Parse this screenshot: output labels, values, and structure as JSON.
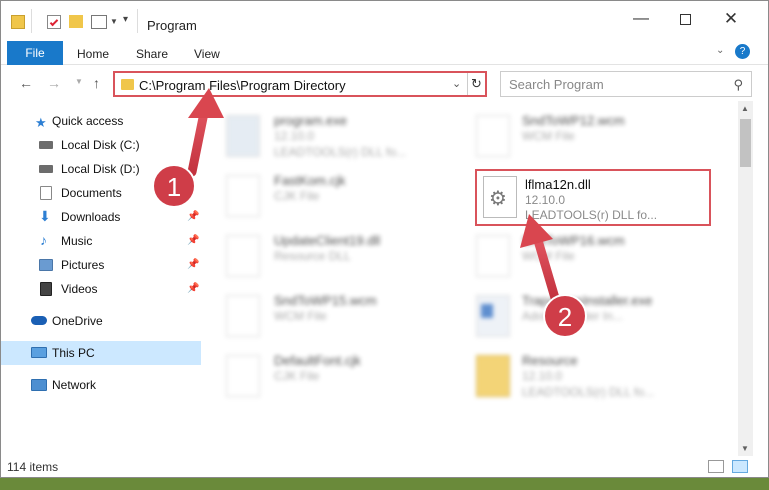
{
  "window": {
    "title": "Program",
    "ribbon_tabs": {
      "file": "File",
      "home": "Home",
      "share": "Share",
      "view": "View"
    }
  },
  "navigation": {
    "address": "C:\\Program Files\\Program Directory",
    "search_placeholder": "Search Program"
  },
  "sidebar": {
    "items": [
      {
        "label": "Quick access",
        "icon": "star-icon"
      },
      {
        "label": "Local Disk (C:)",
        "icon": "drive-icon"
      },
      {
        "label": "Local Disk (D:)",
        "icon": "drive-icon"
      },
      {
        "label": "Documents",
        "icon": "documents-icon"
      },
      {
        "label": "Downloads",
        "icon": "download-icon"
      },
      {
        "label": "Music",
        "icon": "music-icon"
      },
      {
        "label": "Pictures",
        "icon": "pictures-icon"
      },
      {
        "label": "Videos",
        "icon": "videos-icon"
      },
      {
        "label": "OneDrive",
        "icon": "cloud-icon"
      },
      {
        "label": "This PC",
        "icon": "computer-icon"
      },
      {
        "label": "Network",
        "icon": "network-icon"
      }
    ]
  },
  "files": [
    {
      "name": "program.exe",
      "line2": "12.10.0",
      "line3": "LEADTOOLS(r) DLL fo..."
    },
    {
      "name": "SndToWP12.wcm",
      "line2": "WCM File",
      "line3": ""
    },
    {
      "name": "FastKom.cjk",
      "line2": "CJK File",
      "line3": ""
    },
    {
      "name": "lflma12n.dll",
      "line2": "12.10.0",
      "line3": "LEADTOOLS(r) DLL fo..."
    },
    {
      "name": "UpdateClient19.dll",
      "line2": "Resource DLL",
      "line3": ""
    },
    {
      "name": "SndToWP16.wcm",
      "line2": "WCM File",
      "line3": ""
    },
    {
      "name": "SndToWP15.wcm",
      "line2": "WCM File",
      "line3": ""
    },
    {
      "name": "TrapaxonsInstaller.exe",
      "line2": "Adobe Reader In...",
      "line3": ""
    },
    {
      "name": "DefaultFont.cjk",
      "line2": "CJK File",
      "line3": ""
    },
    {
      "name": "Resource",
      "line2": "12.10.0",
      "line3": "LEADTOOLS(r) DLL fo..."
    }
  ],
  "status": {
    "items_count": "114 items"
  },
  "annotations": {
    "step1": "1",
    "step2": "2"
  },
  "colors": {
    "accent": "#1979ca",
    "highlight": "#d9535b",
    "selected": "#cce8ff"
  }
}
